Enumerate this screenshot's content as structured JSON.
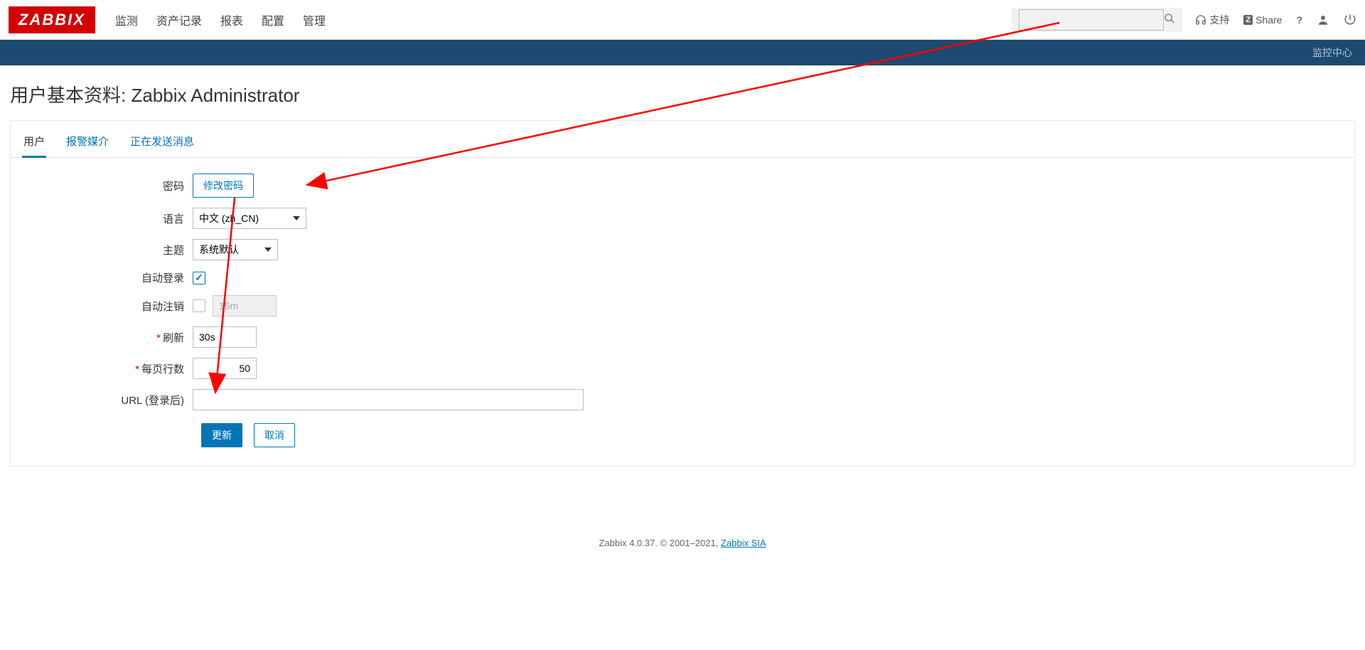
{
  "brand": "ZABBIX",
  "nav": [
    "监测",
    "资产记录",
    "报表",
    "配置",
    "管理"
  ],
  "top": {
    "support": "支持",
    "share": "Share",
    "help": "?"
  },
  "subheader": "监控中心",
  "pageTitle": "用户基本资料: Zabbix Administrator",
  "tabs": [
    "用户",
    "报警媒介",
    "正在发送消息"
  ],
  "form": {
    "password_label": "密码",
    "change_pw_btn": "修改密码",
    "language_label": "语言",
    "language_value": "中文 (zh_CN)",
    "theme_label": "主题",
    "theme_value": "系统默认",
    "autologin_label": "自动登录",
    "autologout_label": "自动注销",
    "autologout_value": "15m",
    "refresh_label": "刷新",
    "refresh_value": "30s",
    "rows_label": "每页行数",
    "rows_value": "50",
    "url_label": "URL (登录后)",
    "url_value": ""
  },
  "buttons": {
    "update": "更新",
    "cancel": "取消"
  },
  "footer": {
    "text": "Zabbix 4.0.37. © 2001–2021, ",
    "link": "Zabbix SIA"
  }
}
